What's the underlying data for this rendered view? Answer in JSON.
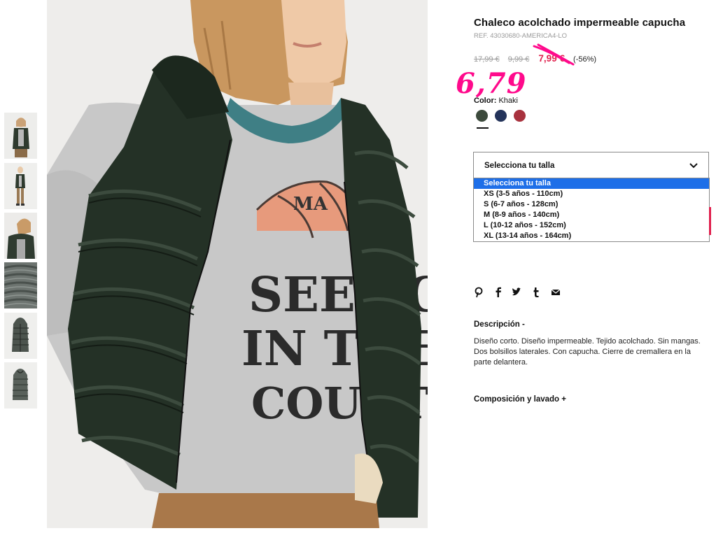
{
  "product": {
    "title": "Chaleco acolchado impermeable capucha",
    "ref": "REF. 43030680-AMERICA4-LO"
  },
  "prices": {
    "old_1": "17,99 €",
    "old_2": "9,99 €",
    "current": "7,99 €",
    "discount": "(-56%)",
    "handwritten_note": "6,79"
  },
  "color": {
    "label": "Color:",
    "selected": "Khaki",
    "swatches": [
      {
        "name": "khaki",
        "hex": "#3c4a3c"
      },
      {
        "name": "navy",
        "hex": "#23335a"
      },
      {
        "name": "red",
        "hex": "#a8323e"
      }
    ]
  },
  "size": {
    "placeholder": "Selecciona tu talla",
    "options": [
      "Selecciona tu talla",
      "XS (3-5 años - 110cm)",
      "S (6-7 años - 128cm)",
      "M (8-9 años - 140cm)",
      "L (10-12 años - 152cm)",
      "XL (13-14 años - 164cm)"
    ],
    "selected_index": 0
  },
  "share": [
    "pinterest-icon",
    "facebook-icon",
    "twitter-icon",
    "tumblr-icon",
    "email-icon"
  ],
  "description": {
    "title": "Descripción -",
    "text": "Diseño corto. Diseño impermeable. Tejido acolchado. Sin mangas. Dos bolsillos laterales. Con capucha. Cierre de cremallera en la parte delantera."
  },
  "composition": {
    "title": "Composición y lavado +"
  },
  "photo": {
    "shirt_print": [
      "SEE YOU",
      "IN THE",
      "COURT"
    ],
    "ball_text": "MA"
  },
  "colors": {
    "accent_red": "#e0204d",
    "handwriting_pink": "#ff0a8c",
    "dropdown_highlight": "#1e6fe8"
  }
}
